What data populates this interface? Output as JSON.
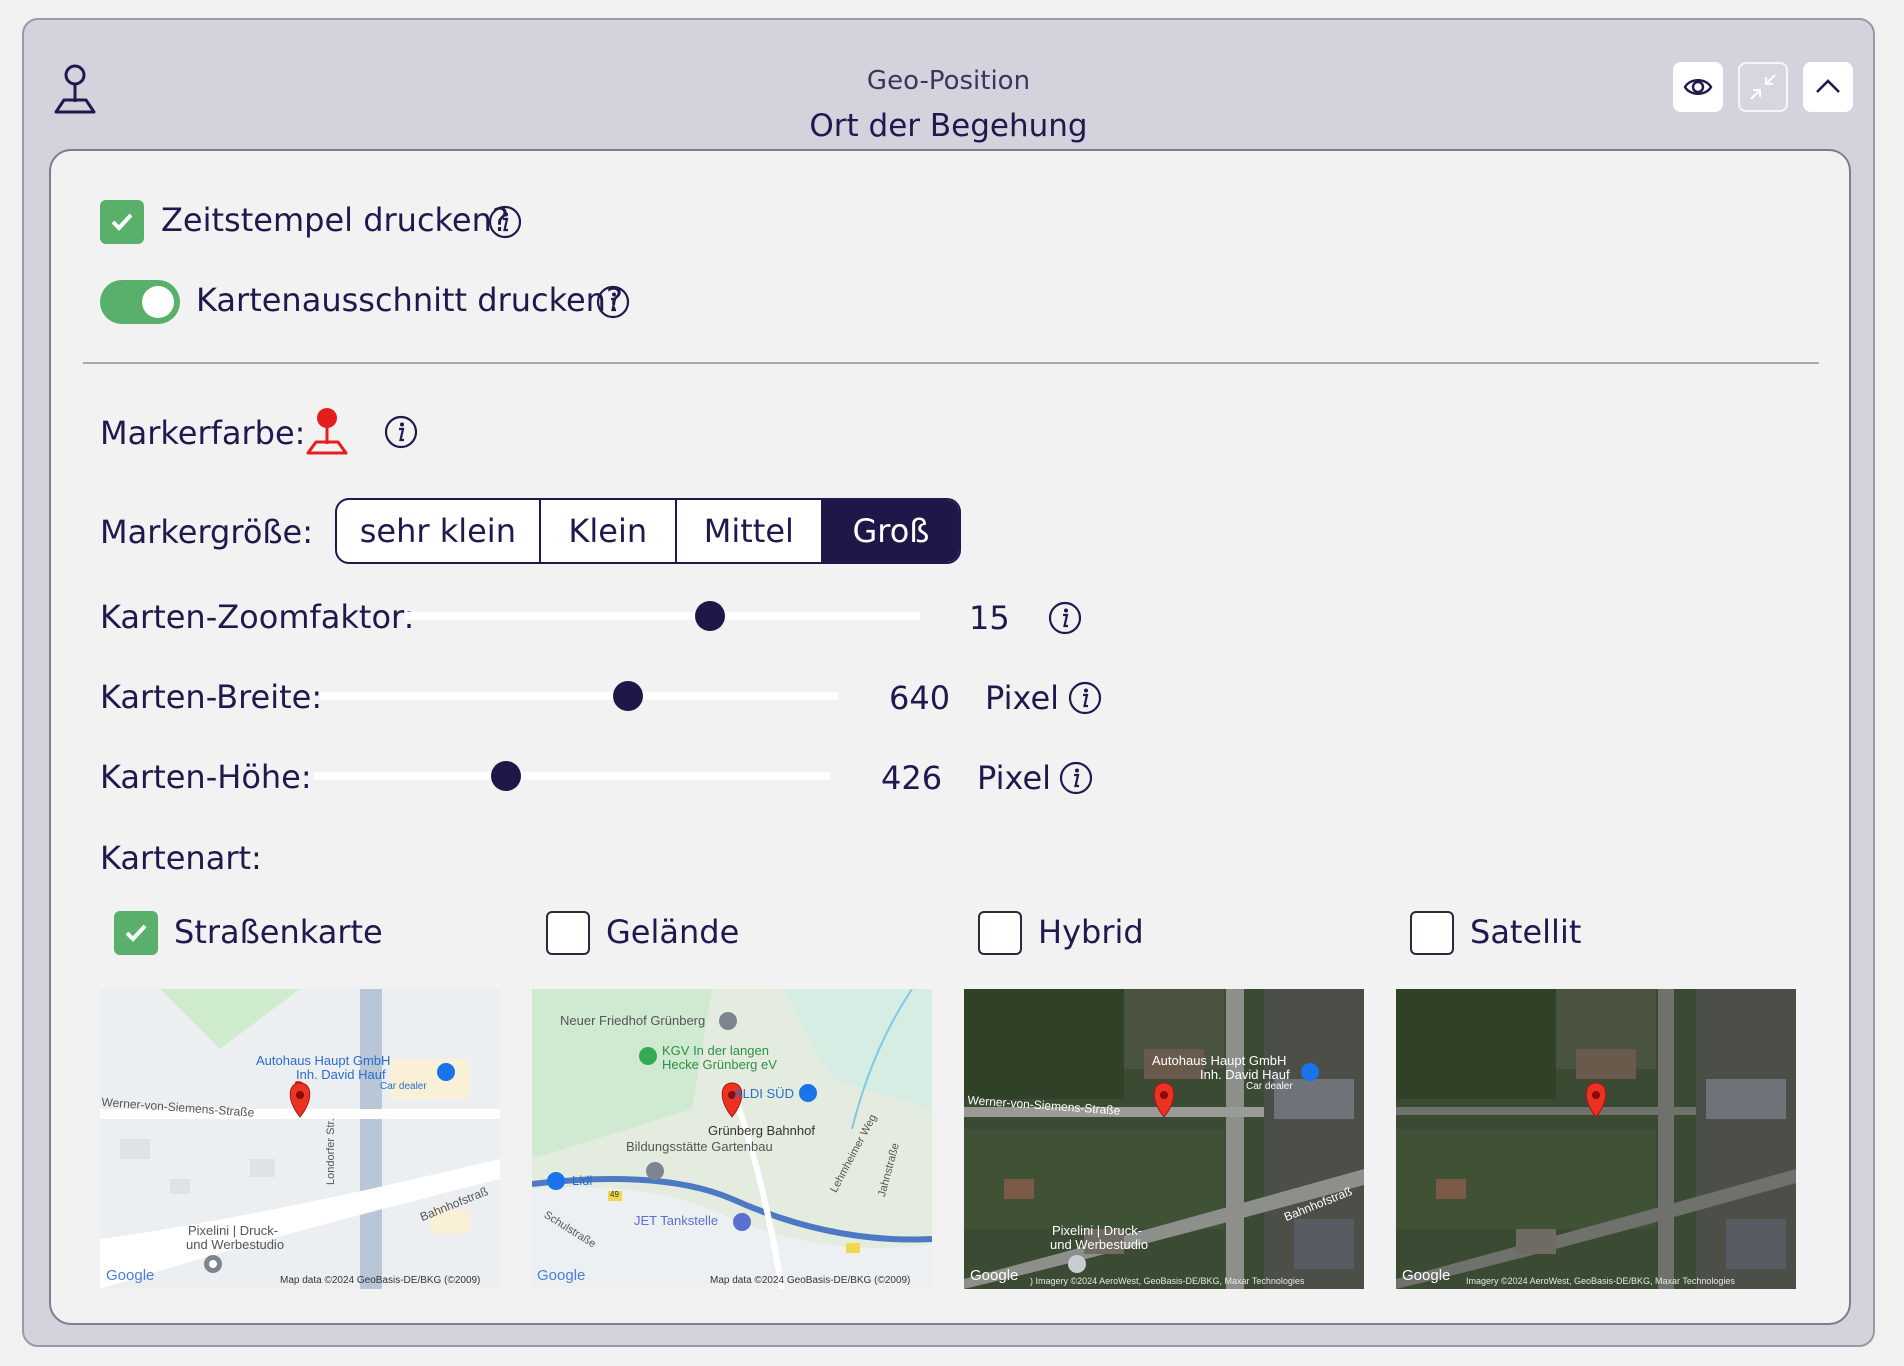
{
  "header": {
    "subtitle": "Geo-Position",
    "title": "Ort der Begehung",
    "buttons": [
      "eye-icon",
      "compress-icon",
      "chevron-up-icon"
    ]
  },
  "options": {
    "timestamp": {
      "label": "Zeitstempel drucken?",
      "checked": true
    },
    "map_excerpt": {
      "label": "Kartenausschnitt drucken?",
      "on": true
    }
  },
  "marker": {
    "color_label": "Markerfarbe:",
    "color": "#e51d1d",
    "size_label": "Markergröße:",
    "sizes": [
      "sehr klein",
      "Klein",
      "Mittel",
      "Groß"
    ],
    "selected_size": "Groß"
  },
  "sliders": {
    "zoom": {
      "label": "Karten-Zoomfaktor:",
      "value": "15",
      "unit": "",
      "fraction": 0.59
    },
    "width": {
      "label": "Karten-Breite:",
      "value": "640",
      "unit": "Pixel",
      "fraction": 0.59
    },
    "height": {
      "label": "Karten-Höhe:",
      "value": "426",
      "unit": "Pixel",
      "fraction": 0.37
    }
  },
  "maptype": {
    "label": "Kartenart:",
    "options": [
      {
        "label": "Straßenkarte",
        "checked": true
      },
      {
        "label": "Gelände",
        "checked": false
      },
      {
        "label": "Hybrid",
        "checked": false
      },
      {
        "label": "Satellit",
        "checked": false
      }
    ]
  },
  "previews": {
    "road": {
      "business1": "Autohaus Haupt GmbH",
      "business2": "Inh. David Hauf",
      "business3": "Car dealer",
      "street1": "Werner-von-Siemens-Straße",
      "street2": "Londorfer Str.",
      "street3": "Bahnhofstraß",
      "poi1": "Pixelini | Druck-",
      "poi2": "und Werbestudio",
      "brand": "Google",
      "credit": "Map data ©2024 GeoBasis-DE/BKG (©2009)"
    },
    "terrain": {
      "poi1": "Neuer Friedhof Grünberg",
      "poi2": "KGV In der langen",
      "poi3": "Hecke Grünberg eV",
      "poi4": "ALDI SÜD",
      "poi5": "Grünberg Bahnhof",
      "poi6": "Bildungsstätte Gartenbau",
      "poi7": "Lidl",
      "poi8": "JET Tankstelle",
      "street1": "Schulstraße",
      "street2": "Lehmheimer Weg",
      "street3": "Jahnstraße",
      "road_num": "49",
      "brand": "Google",
      "credit": "Map data ©2024 GeoBasis-DE/BKG (©2009)"
    },
    "hybrid": {
      "business1": "Autohaus Haupt GmbH",
      "business2": "Inh. David Hauf",
      "business3": "Car dealer",
      "street1": "Werner-von-Siemens-Straße",
      "street3": "Bahnhofstraß",
      "poi1": "Pixelini | Druck-",
      "poi2": "und Werbestudio",
      "brand": "Google",
      "credit": ") Imagery ©2024 AeroWest, GeoBasis-DE/BKG, Maxar Technologies"
    },
    "satellite": {
      "brand": "Google",
      "credit": "Imagery ©2024 AeroWest, GeoBasis-DE/BKG, Maxar Technologies"
    }
  }
}
